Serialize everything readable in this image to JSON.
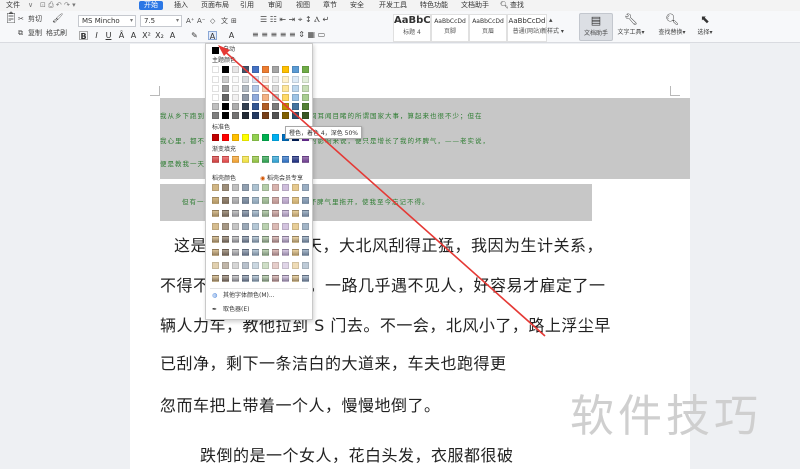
{
  "menu": {
    "items": [
      "文件",
      "开始",
      "插入",
      "页面布局",
      "引用",
      "审阅",
      "视图",
      "章节",
      "安全",
      "开发工具",
      "特色功能",
      "文档助手"
    ],
    "search": "查找"
  },
  "ribbon": {
    "cut": "剪切",
    "copy": "复制",
    "format_painter": "格式刷",
    "font": "MS Mincho",
    "size": "7.5",
    "styles": [
      {
        "preview": "AaBbC",
        "caption": "标题 4"
      },
      {
        "preview": "AaBbCcDd",
        "caption": "页脚"
      },
      {
        "preview": "AaBbCcDd",
        "caption": "页眉"
      },
      {
        "preview": "AaBbCcDd",
        "caption": "普通(网站)"
      }
    ],
    "new_style": "新样式",
    "doc_assistant": "文档助手",
    "text_tools": "文字工具",
    "find_replace": "查找替换",
    "select": "选择"
  },
  "document": {
    "green_lines": [
      "我从乡下跑到京城里，一转眼已经六年了。其间耳闻目睹的所谓国家大事，算起来也很不少；但在",
      "我心里，都不留什么痕迹，倘要我寻出这些事的影响来说，便只是增长了我的坏脾气，——老实说，",
      "便是教我一天比一天的看不起人。",
      "但有一件小事，却于我有意义，将我从坏脾气里拖开，使我至今忘记不得。"
    ],
    "body_lines": [
      "这是民国六年的冬天，大北风刮得正猛，我因为生计关系，",
      "不得不一早在路上走。一路几乎遇不见人，好容易才雇定了一",
      "辆人力车，教他拉到 S 门去。不一会，北风小了，路上浮尘早",
      "已刮净，剩下一条洁白的大道来，车夫也跑得更",
      "忽而车把上带着一个人，慢慢地倒了。",
      "跌倒的是一个女人，花白头发，衣服都很破"
    ]
  },
  "color_panel": {
    "auto": "自动",
    "theme_colors": "主题颜色",
    "standard_colors": "标准色",
    "gradient_fill": "渐变填充",
    "paper_colors": "稻壳颜色",
    "member": "稻壳会员专享",
    "more_colors": "其他字体颜色(M)...",
    "picker": "取色器(E)",
    "tooltip": "橙色，着色 4，深色 50%",
    "theme_top": [
      "#ffffff",
      "#000000",
      "#e7e6e6",
      "#44546a",
      "#4472c4",
      "#ed7d31",
      "#a5a5a5",
      "#ffc000",
      "#5b9bd5",
      "#70ad47"
    ],
    "standard": [
      "#c00000",
      "#ff0000",
      "#ffc000",
      "#ffff00",
      "#92d050",
      "#00b050",
      "#00b0f0",
      "#0070c0",
      "#002060",
      "#7030a0"
    ],
    "gradient": [
      "#d04040",
      "#e04848",
      "#f0a030",
      "#f0e040",
      "#90c040",
      "#30a050",
      "#30a0d0",
      "#3070c0",
      "#203080",
      "#704090"
    ]
  },
  "watermark": "软件技巧"
}
